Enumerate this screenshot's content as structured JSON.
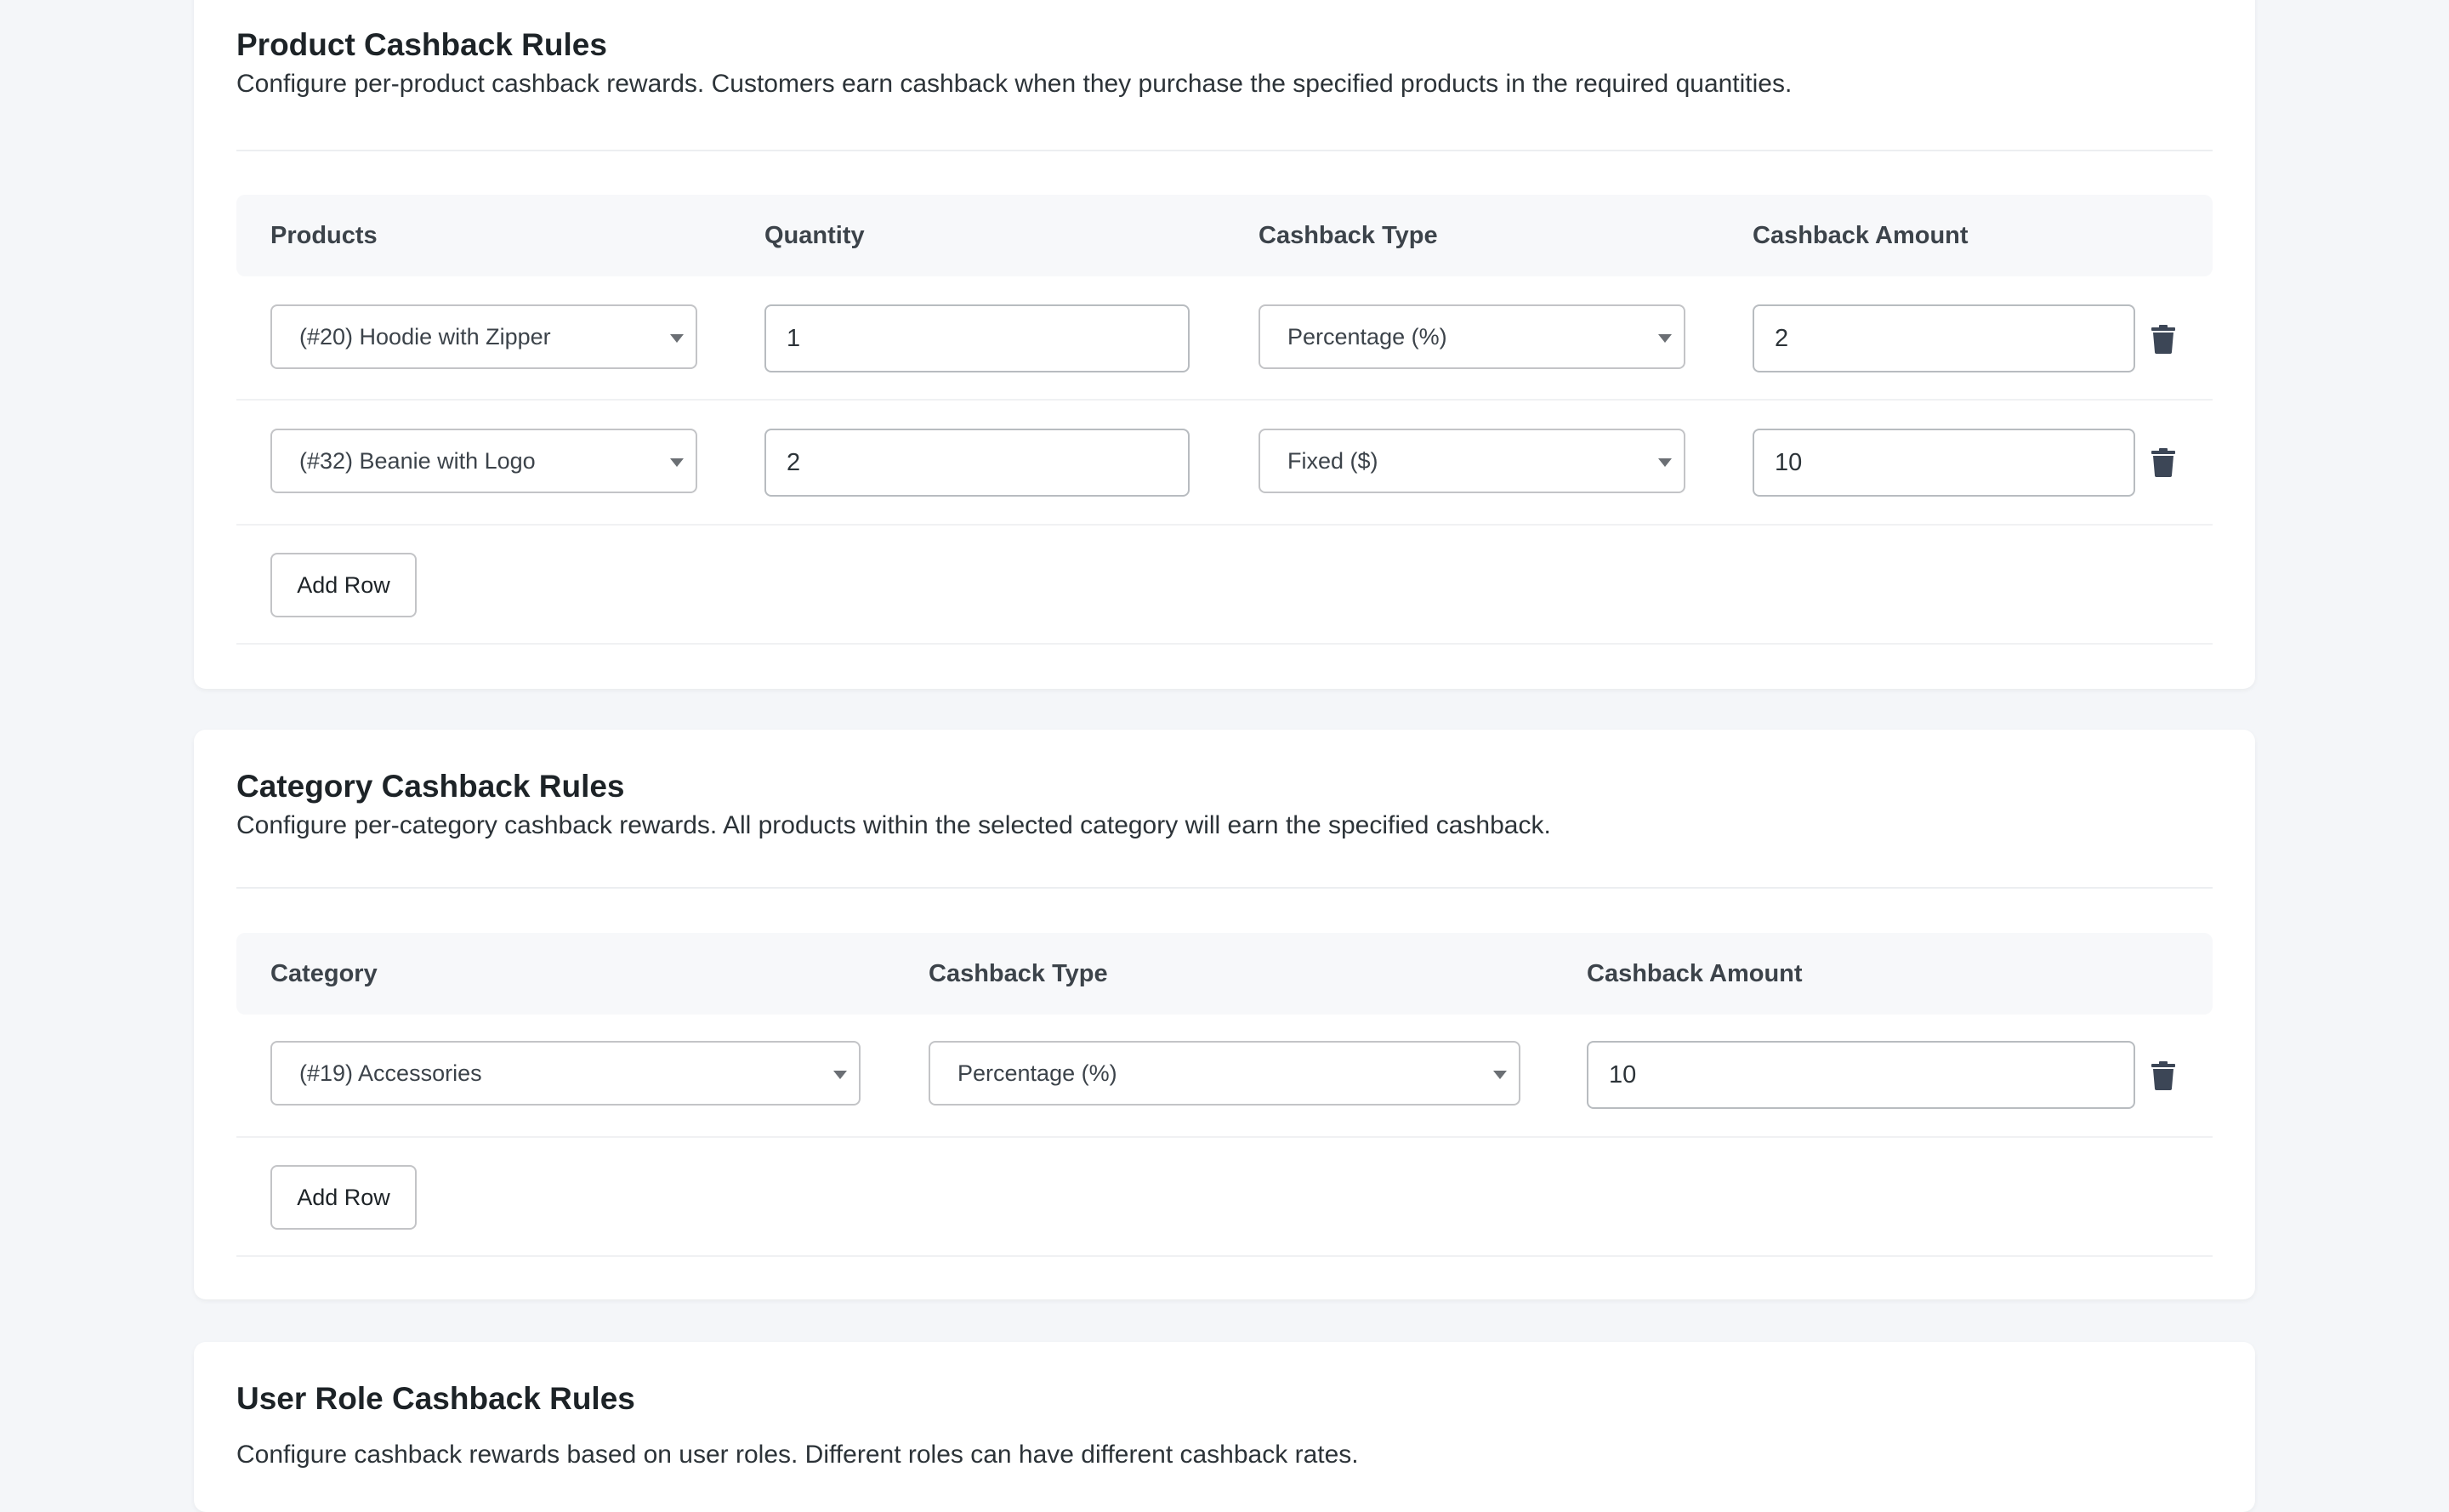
{
  "product_rules": {
    "title": "Product Cashback Rules",
    "description": "Configure per-product cashback rewards. Customers earn cashback when they purchase the specified products in the required quantities.",
    "headers": [
      "Products",
      "Quantity",
      "Cashback Type",
      "Cashback Amount"
    ],
    "rows": [
      {
        "product": "(#20) Hoodie with Zipper",
        "quantity": "1",
        "type": "Percentage (%)",
        "amount": "2"
      },
      {
        "product": "(#32) Beanie with Logo",
        "quantity": "2",
        "type": "Fixed ($)",
        "amount": "10"
      }
    ],
    "add_row_label": "Add Row"
  },
  "category_rules": {
    "title": "Category Cashback Rules",
    "description": "Configure per-category cashback rewards. All products within the selected category will earn the specified cashback.",
    "headers": [
      "Category",
      "Cashback Type",
      "Cashback Amount"
    ],
    "rows": [
      {
        "category": "(#19) Accessories",
        "type": "Percentage (%)",
        "amount": "10"
      }
    ],
    "add_row_label": "Add Row"
  },
  "user_role_rules": {
    "title": "User Role Cashback Rules",
    "description": "Configure cashback rewards based on user roles. Different roles can have different cashback rates."
  },
  "icons": {
    "row_delete": "trash-icon",
    "select_caret": "chevron-down-icon"
  },
  "colors": {
    "page_background": "#f4f6f9",
    "card_background": "#ffffff",
    "trash_icon": "#3c4656"
  }
}
